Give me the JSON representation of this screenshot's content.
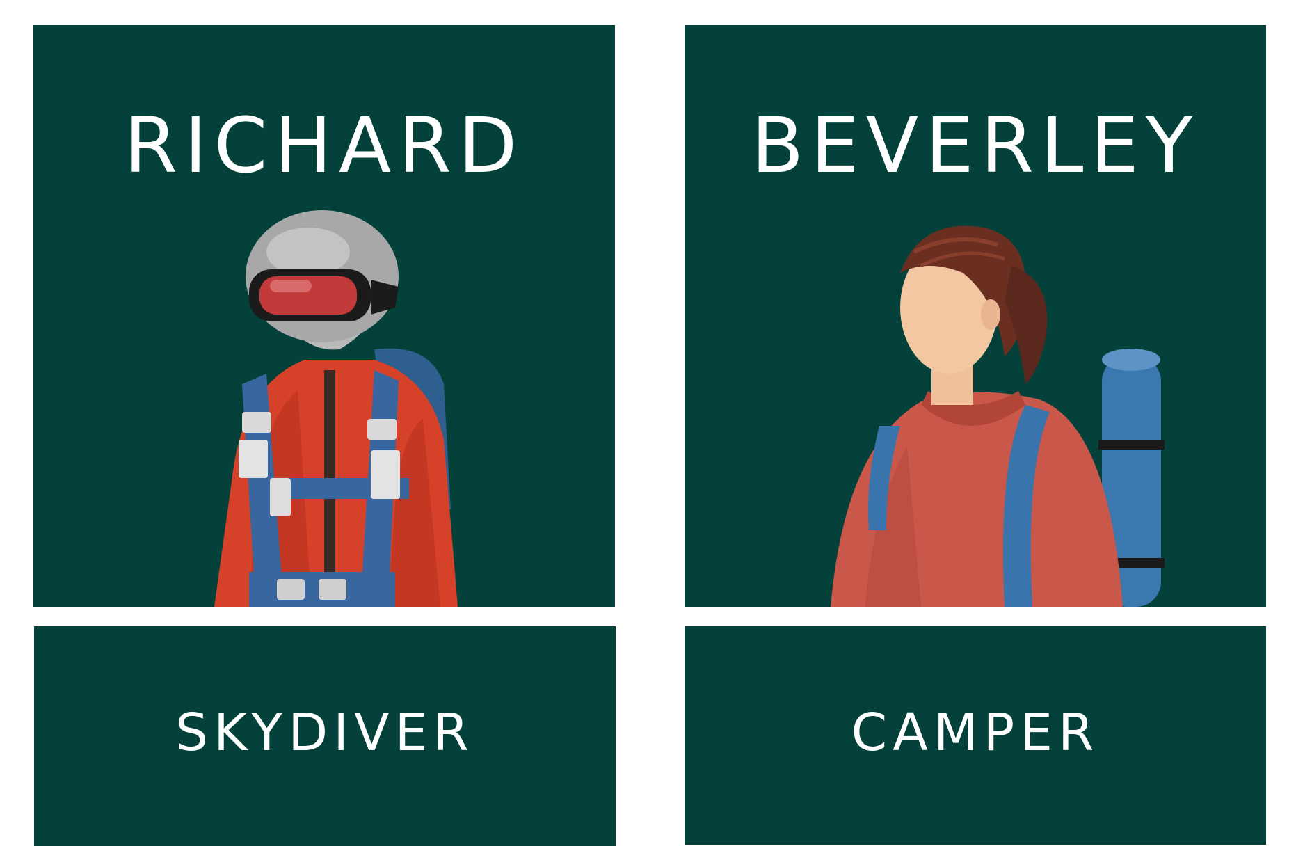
{
  "cards": [
    {
      "name": "RICHARD",
      "role": "SKYDIVER"
    },
    {
      "name": "BEVERLEY",
      "role": "CAMPER"
    }
  ],
  "colors": {
    "card_background": "#03413a",
    "text": "#ffffff",
    "page_background": "#ffffff"
  }
}
